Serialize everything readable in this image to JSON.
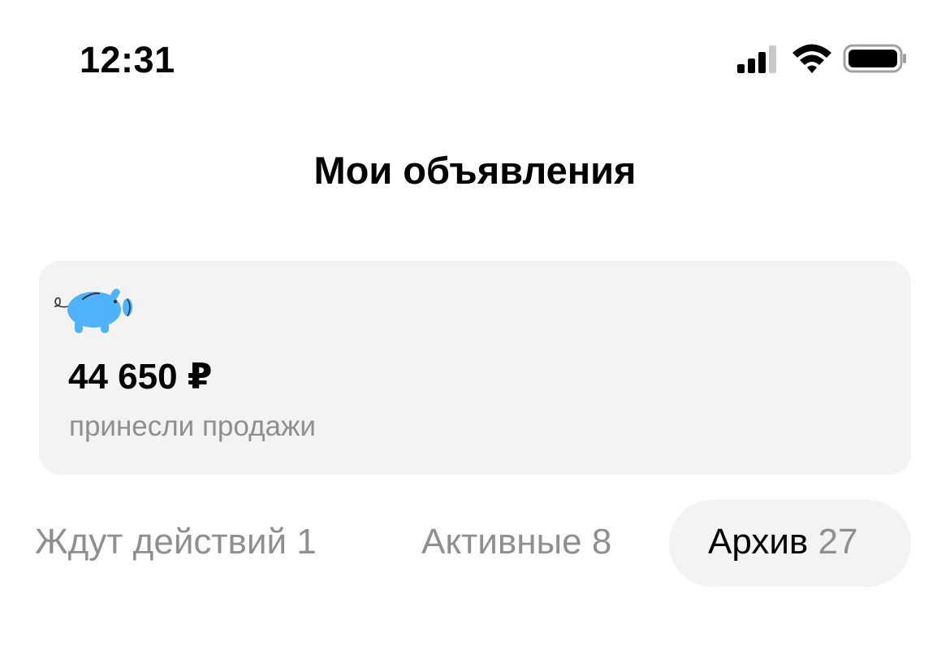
{
  "status_bar": {
    "time": "12:31",
    "icons": [
      "signal-icon",
      "wifi-icon",
      "battery-icon"
    ]
  },
  "header": {
    "title": "Мои объявления"
  },
  "sales_card": {
    "icon": "piggy-bank-icon",
    "icon_color": "#4eb3fa",
    "amount": "44 650 ₽",
    "caption": "принесли продажи",
    "background": "#f3f3f3"
  },
  "tabs": [
    {
      "label": "Ждут действий 1",
      "selected": false
    },
    {
      "label": "Активные 8",
      "selected": false
    },
    {
      "label": "Архив",
      "count": "27",
      "selected": true
    }
  ],
  "colors": {
    "text_primary": "#000000",
    "text_secondary": "#8f8f8f",
    "surface": "#f3f3f3",
    "accent": "#4eb3fa"
  }
}
